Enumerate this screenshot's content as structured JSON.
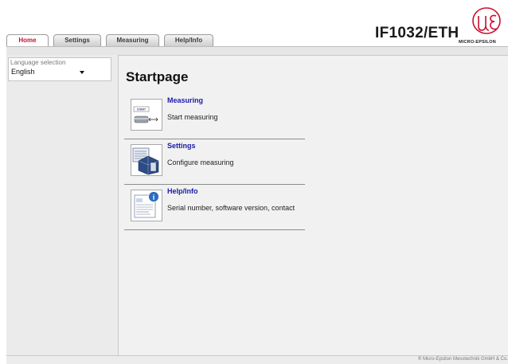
{
  "header": {
    "tabs": [
      {
        "label": "Home",
        "active": true
      },
      {
        "label": "Settings",
        "active": false
      },
      {
        "label": "Measuring",
        "active": false
      },
      {
        "label": "Help/Info",
        "active": false
      }
    ],
    "device_title": "IF1032/ETH",
    "logo_text": "MICRO-EPSILON"
  },
  "sidebar": {
    "language_label": "Language selection",
    "language_value": "English"
  },
  "main": {
    "title": "Startpage",
    "items": [
      {
        "title": "Measuring",
        "description": "Start measuring",
        "icon": "start-measuring-icon"
      },
      {
        "title": "Settings",
        "description": "Configure measuring",
        "icon": "settings-panel-icon"
      },
      {
        "title": "Help/Info",
        "description": "Serial number, software version, contact",
        "icon": "info-document-icon"
      }
    ]
  },
  "footer": {
    "copyright": "® Micro-Epsilon Messtechnik GmbH & Co."
  },
  "colors": {
    "active_tab_text": "#c8102e",
    "link_blue": "#1a1aa8",
    "logo_red": "#c8102e"
  }
}
